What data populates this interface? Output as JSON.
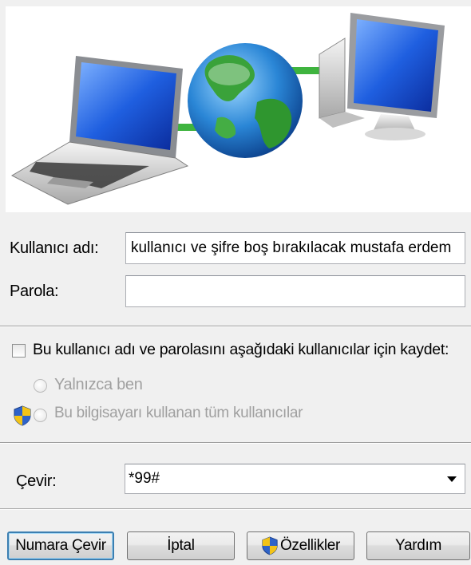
{
  "banner": {
    "icons": [
      "laptop-icon",
      "globe-icon",
      "desktop-computer-icon"
    ]
  },
  "form": {
    "username_label": "Kullanıcı adı:",
    "username_value": "kullanıcı ve şifre boş bırakılacak mustafa erdem",
    "password_label": "Parola:",
    "password_value": ""
  },
  "save": {
    "checkbox_label": "Bu kullanıcı adı ve parolasını aşağıdaki kullanıcılar için kaydet:",
    "checked": false,
    "options": [
      "Yalnızca ben",
      "Bu bilgisayarı kullanan tüm kullanıcılar"
    ]
  },
  "dial": {
    "label": "Çevir:",
    "value": "*99#"
  },
  "buttons": {
    "dial": "Numara Çevir",
    "cancel": "İptal",
    "properties": "Özellikler",
    "help": "Yardım"
  },
  "colors": {
    "link_green": "#3fb43f",
    "default_button_border": "#3c7fb1"
  }
}
